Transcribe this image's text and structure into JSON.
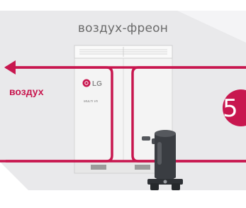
{
  "diagram": {
    "caption": "воздух-фреон",
    "side_label": "воздух",
    "step_number": "5",
    "unit_brand": "LG",
    "unit_model": "MULTI V5"
  },
  "colors": {
    "accent": "#c8174f",
    "background": "#ffffff",
    "panel": "#e9e9eb",
    "unit_body": "#f4f4f4",
    "caption_text": "#6b6b6b",
    "compressor": "#3a3d42"
  },
  "icons": {
    "flow_arrow": "arrow-left-icon",
    "compressor": "compressor-icon",
    "logo": "lg-logo-icon"
  }
}
